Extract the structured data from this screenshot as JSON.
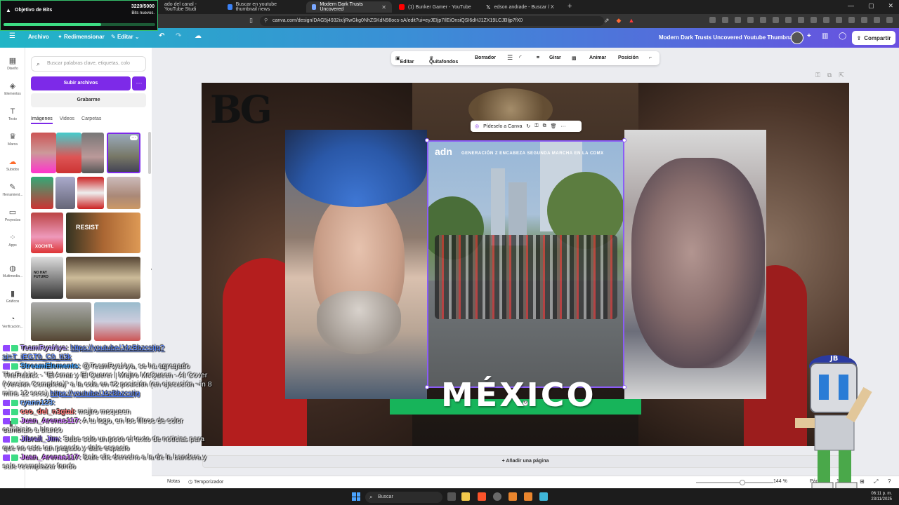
{
  "browser": {
    "tabs": [
      {
        "label": "ado del canal - YouTube Studi"
      },
      {
        "label": "Buscar en youtube thumbnail news"
      },
      {
        "label": "Modern Dark Trusts Uncovered"
      },
      {
        "label": "(1) Bunker Gamer - YouTube"
      },
      {
        "label": "edson andrade - Buscar / X"
      }
    ],
    "address": "canva.com/design/DAG5j4932ix/jRwGkg0NhZSKdN98ocs-sA/edit?ui=eyJEIjp7IlEiOnsiQSI6dHJ1ZX19LCJBIjp7fX0"
  },
  "canva": {
    "menu": {
      "file": "Archivo",
      "resize": "Redimensionar",
      "edit": "Editar"
    },
    "doc_title": "Modern Dark Trusts Uncovered Youtube Thumbnail",
    "share": "Compartir",
    "rail": [
      {
        "label": "Diseño"
      },
      {
        "label": "Elementos"
      },
      {
        "label": "Texto"
      },
      {
        "label": "Marca"
      },
      {
        "label": "Subidos"
      },
      {
        "label": "Herramient..."
      },
      {
        "label": "Proyectos"
      },
      {
        "label": "Apps"
      },
      {
        "label": "Multimedia..."
      },
      {
        "label": "Gráficos"
      },
      {
        "label": "Verificación..."
      },
      {
        "label": "TypeExtrude"
      }
    ],
    "panel": {
      "search_placeholder": "Buscar palabras clave, etiquetas, colo",
      "upload": "Subir archivos",
      "more": "···",
      "record": "Grabarme",
      "tabs": [
        "Imágenes",
        "Videos",
        "Carpetas"
      ],
      "thumb_texts": {
        "xochitl": "XOCHITL",
        "resist": "RESIST",
        "future": "NO HAY FUTURO"
      }
    },
    "context_toolbar": [
      "Editar",
      "Quitafondos",
      "Borrador",
      "Girar",
      "Animar",
      "Posición"
    ],
    "float_toolbar": "Pídeselo a Canva",
    "design": {
      "bg_logo": "BG",
      "news_logo": "adn",
      "news_banner": "GENERACIÓN Z ENCABEZA SEGUNDA MARCHA EN LA CDMX",
      "headline": "MÉXICO"
    },
    "add_page": "+ Añadir una página",
    "bottom": {
      "notes": "Notas",
      "timer": "Temporizador",
      "zoom": "144 %",
      "pages": "Páginas",
      "page_num": "1"
    }
  },
  "stream": {
    "bits_title": "Objetivo de Bits",
    "bits_count": "3220/5000",
    "bits_sub": "Bits nuevos.",
    "bits_progress": 0.644,
    "chat": [
      {
        "user": "TeamRyaNya:",
        "text": "",
        "link": "https://youtube/J4zBbzcstjg?si=T_iEGT0_C0_tI3k"
      },
      {
        "user": "StreamElements:",
        "text": "@TeamRyaNya, se ha agregado TheRubick - \"El Amar y El Querer | Mejiro McQueen - AI Cover (Version Completa)\" a la cola en #2 posición (en ejecución ~in 8 mins 12 secs)",
        "link": "https://youtube/J4zBbzcstjg"
      },
      {
        "user": "ryann123:",
        "text": "",
        "link": ""
      },
      {
        "user": "ceo_del_n3gtal:",
        "text": "mejiro mcqueen",
        "link": ""
      },
      {
        "user": "Juan_Arenas117:",
        "text": "A tu logo, en los filtros de color cambialo a blanco",
        "link": ""
      },
      {
        "user": "Jibrail_Jim:",
        "text": "Sube solo un poco el texto de noticias para que no este tan pegado y dale espacio",
        "link": ""
      },
      {
        "user": "Juan_Arenas117:",
        "text": "Dale clic derecho a la de la bandera y sale reemplazar fondo",
        "link": ""
      }
    ],
    "mascot_badge": "JB"
  },
  "taskbar": {
    "search": "Buscar",
    "time": "06:11 p. m.",
    "date": "23/11/2025"
  },
  "colors": {
    "canva_purple": "#7d2ae8",
    "headline_bar": "#17b45a",
    "bits_green": "#3ddc84"
  }
}
